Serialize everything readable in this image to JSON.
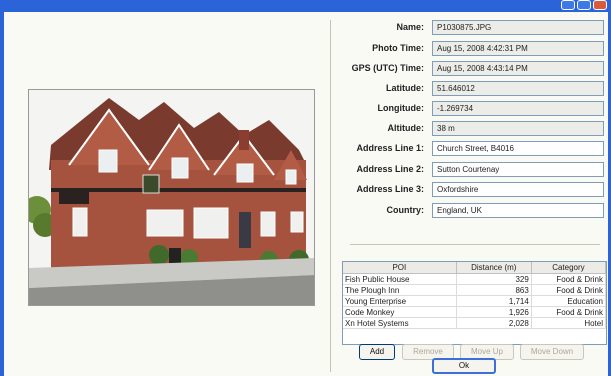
{
  "window": {
    "buttons": [
      "minimize",
      "maximize",
      "close"
    ]
  },
  "fields": [
    {
      "label": "Name:",
      "value": "P1030875.JPG",
      "readonly": true
    },
    {
      "label": "Photo Time:",
      "value": "Aug 15, 2008 4:42:31 PM",
      "readonly": true
    },
    {
      "label": "GPS (UTC) Time:",
      "value": "Aug 15, 2008 4:43:14 PM",
      "readonly": true
    },
    {
      "label": "Latitude:",
      "value": "51.646012",
      "readonly": true
    },
    {
      "label": "Longitude:",
      "value": "-1.269734",
      "readonly": true
    },
    {
      "label": "Altitude:",
      "value": "38 m",
      "readonly": true
    },
    {
      "label": "Address Line 1:",
      "value": "Church Street, B4016",
      "readonly": false
    },
    {
      "label": "Address Line 2:",
      "value": "Sutton Courtenay",
      "readonly": false
    },
    {
      "label": "Address Line 3:",
      "value": "Oxfordshire",
      "readonly": false
    },
    {
      "label": "Country:",
      "value": "England, UK",
      "readonly": false
    }
  ],
  "poi": {
    "columns": [
      "POI",
      "Distance (m)",
      "Category"
    ],
    "rows": [
      [
        "Fish Public House",
        "329",
        "Food & Drink"
      ],
      [
        "The Plough Inn",
        "863",
        "Food & Drink"
      ],
      [
        "Young Enterprise",
        "1,714",
        "Education"
      ],
      [
        "Code Monkey",
        "1,926",
        "Food & Drink"
      ],
      [
        "Xn Hotel Systems",
        "2,028",
        "Hotel"
      ]
    ]
  },
  "buttons": {
    "add": "Add",
    "remove": "Remove",
    "move_up": "Move Up",
    "move_down": "Move Down",
    "ok": "Ok"
  }
}
